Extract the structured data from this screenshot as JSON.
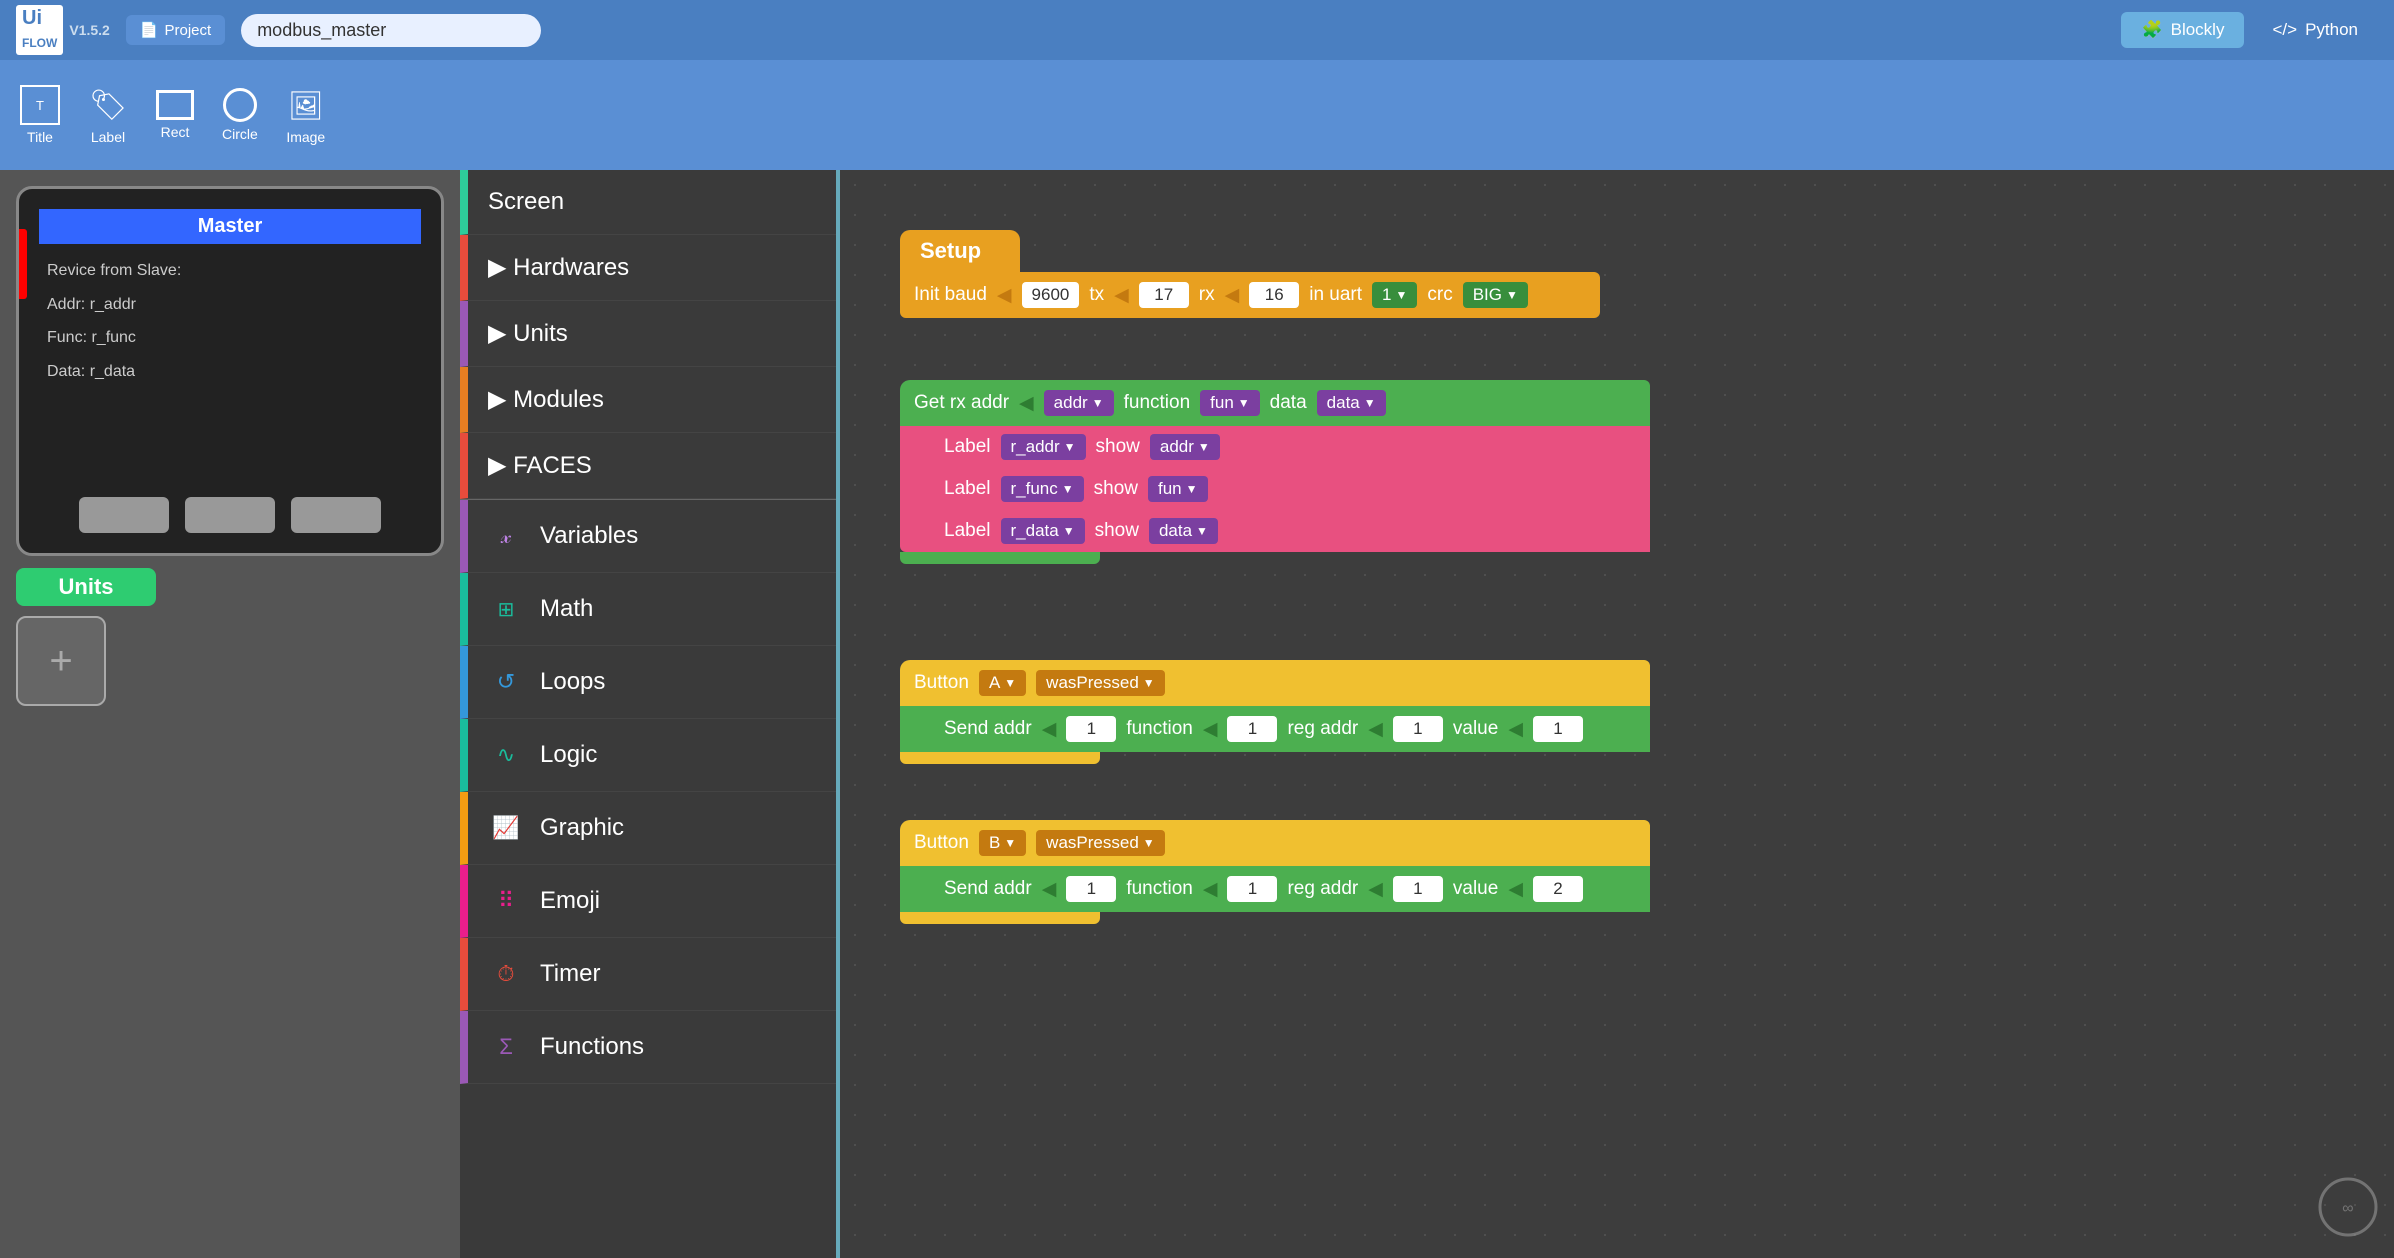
{
  "app": {
    "logo": "Ui\nFLOW",
    "version": "V1.5.2",
    "project_label": "Project",
    "project_name": "modbus_master",
    "blockly_label": "Blockly",
    "python_label": "Python"
  },
  "toolbar": {
    "items": [
      {
        "name": "Title",
        "icon": "⊞"
      },
      {
        "name": "Label",
        "icon": "🏷"
      },
      {
        "name": "Rect",
        "icon": "▭"
      },
      {
        "name": "Circle",
        "icon": "○"
      },
      {
        "name": "Image",
        "icon": "🖼"
      }
    ]
  },
  "device": {
    "screen_title": "Master",
    "lines": [
      "Revice from Slave:",
      "Addr:  r_addr",
      "Func:  r_func",
      "Data:  r_data"
    ]
  },
  "sidebar": {
    "units_label": "Units",
    "add_label": "+",
    "categories": [
      {
        "id": "screen",
        "label": "Screen",
        "icon": "📺",
        "css_class": "cat-screen"
      },
      {
        "id": "hardwares",
        "label": "▶ Hardwares",
        "icon": "",
        "css_class": "cat-hardwares"
      },
      {
        "id": "units",
        "label": "▶ Units",
        "icon": "",
        "css_class": "cat-units"
      },
      {
        "id": "modules",
        "label": "▶ Modules",
        "icon": "",
        "css_class": "cat-modules"
      },
      {
        "id": "faces",
        "label": "▶ FACES",
        "icon": "",
        "css_class": "cat-faces"
      },
      {
        "id": "variables",
        "label": "Variables",
        "icon": "𝓍",
        "css_class": "cat-variables"
      },
      {
        "id": "math",
        "label": "Math",
        "icon": "±",
        "css_class": "cat-math"
      },
      {
        "id": "loops",
        "label": "Loops",
        "icon": "↺",
        "css_class": "cat-loops"
      },
      {
        "id": "logic",
        "label": "Logic",
        "icon": "∿",
        "css_class": "cat-logic"
      },
      {
        "id": "graphic",
        "label": "Graphic",
        "icon": "📈",
        "css_class": "cat-graphic"
      },
      {
        "id": "emoji",
        "label": "Emoji",
        "icon": "⠿",
        "css_class": "cat-emoji"
      },
      {
        "id": "timer",
        "label": "Timer",
        "icon": "⏱",
        "css_class": "cat-timer"
      },
      {
        "id": "functions",
        "label": "Functions",
        "icon": "Σ",
        "css_class": "cat-functions"
      }
    ]
  },
  "blocks": {
    "setup": {
      "hat": "Setup",
      "body": "Init baud",
      "baud_val": "9600",
      "tx_label": "tx",
      "tx_val": "17",
      "rx_label": "rx",
      "rx_val": "16",
      "uart_label": "in uart",
      "uart_val": "1",
      "crc_label": "crc",
      "crc_val": "BIG"
    },
    "getrx": {
      "label": "Get rx addr",
      "addr_label": "addr",
      "function_label": "function",
      "fun_label": "fun",
      "data_label": "data",
      "data_val": "data",
      "sub1": {
        "label_label": "Label",
        "addr_drop": "r_addr",
        "show_label": "show",
        "show_drop": "addr"
      },
      "sub2": {
        "label_label": "Label",
        "func_drop": "r_func",
        "show_label": "show",
        "show_drop": "fun"
      },
      "sub3": {
        "label_label": "Label",
        "data_drop": "r_data",
        "show_label": "show",
        "show_drop": "data"
      }
    },
    "buttonA": {
      "hat": "Button",
      "button_val": "A",
      "event_val": "wasPressed",
      "body": "Send addr",
      "addr_val": "1",
      "function_label": "function",
      "func_val": "1",
      "reg_label": "reg addr",
      "reg_val": "1",
      "value_label": "value",
      "value_val": "1"
    },
    "buttonB": {
      "hat": "Button",
      "button_val": "B",
      "event_val": "wasPressed",
      "body": "Send addr",
      "addr_val": "1",
      "function_label": "function",
      "func_val": "1",
      "reg_label": "reg addr",
      "reg_val": "1",
      "value_label": "value",
      "value_val": "2"
    }
  }
}
